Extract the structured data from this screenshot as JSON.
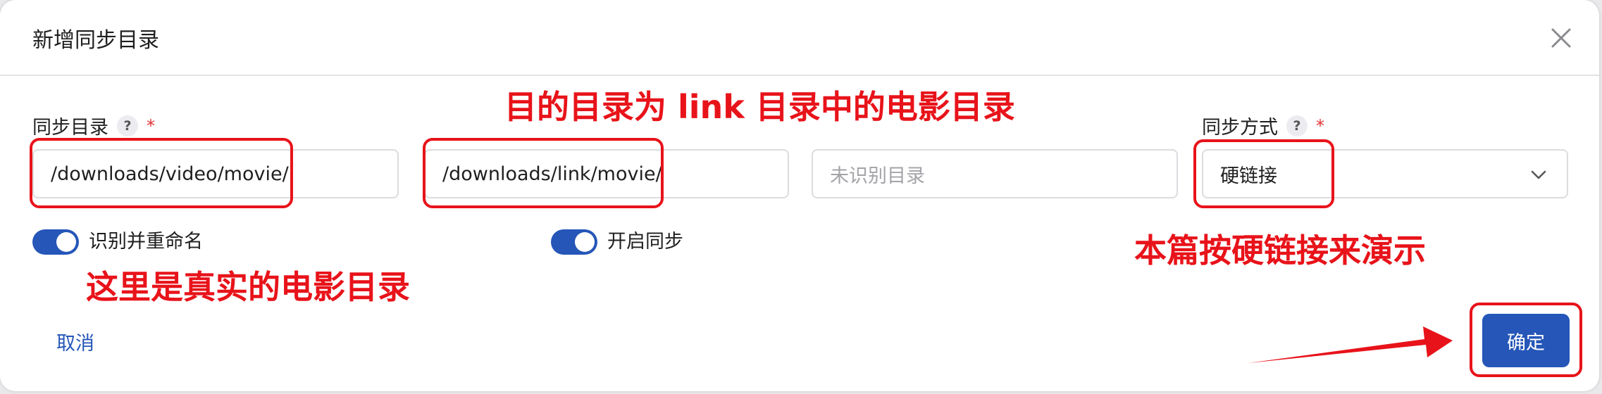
{
  "dialog": {
    "title": "新增同步目录"
  },
  "fields": {
    "sync_dir_label": "同步目录",
    "help_glyph": "?",
    "required_mark": "*",
    "source_value": "/downloads/video/movie/",
    "target_value": "/downloads/link/movie/",
    "unrecognized_placeholder": "未识别目录",
    "sync_mode_label": "同步方式",
    "sync_mode_value": "硬链接"
  },
  "toggles": {
    "rename_label": "识别并重命名",
    "enable_sync_label": "开启同步"
  },
  "footer": {
    "cancel_label": "取消",
    "confirm_label": "确定"
  },
  "annotations": {
    "target_note": "目的目录为 link 目录中的电影目录",
    "source_note": "这里是真实的电影目录",
    "mode_note": "本篇按硬链接来演示"
  },
  "colors": {
    "accent": "#2556b8",
    "annotation": "#e8131a",
    "required": "#e03131"
  },
  "icons": {
    "close": "close-icon",
    "help": "help-icon",
    "chevron": "chevron-down-icon"
  }
}
